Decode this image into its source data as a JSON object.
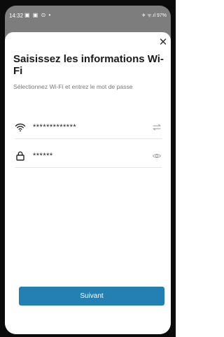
{
  "statusbar": {
    "time": "14:32",
    "left_icons": "▣ ▣ ⊙ •",
    "right_text": "✈ ᯤ.ıl 97%"
  },
  "dialog": {
    "close_label": "✕",
    "title": "Saisissez les informations Wi-Fi",
    "subtitle": "Sélectionnez Wi-Fi et entrez le mot de passe"
  },
  "form": {
    "wifi_value": "*************",
    "password_value": "******"
  },
  "actions": {
    "next_label": "Suivant"
  },
  "colors": {
    "accent": "#2480b3",
    "backdrop": "#7d7d7d"
  },
  "icons": {
    "wifi": "wifi-icon",
    "lock": "lock-icon",
    "switch": "swap-icon",
    "eye": "eye-icon",
    "close": "close-icon"
  }
}
